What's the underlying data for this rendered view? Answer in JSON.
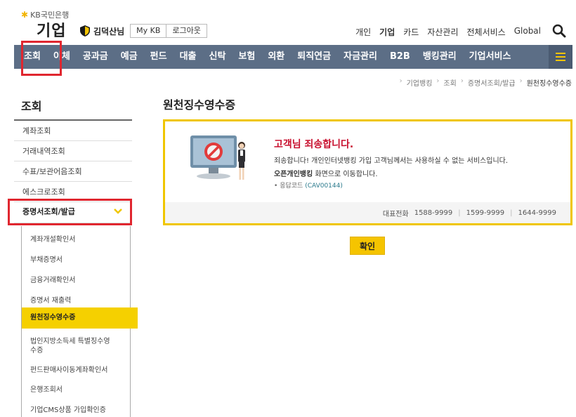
{
  "header": {
    "logo_sub": "KB국민은행",
    "logo_main": "기업",
    "user_name": "김덕산님",
    "my_kb": "My KB",
    "logout": "로그아웃",
    "top_links": [
      {
        "label": "개인",
        "bold": false
      },
      {
        "label": "기업",
        "bold": true
      },
      {
        "label": "카드",
        "bold": false
      },
      {
        "label": "자산관리",
        "bold": false
      },
      {
        "label": "전체서비스",
        "bold": false
      },
      {
        "label": "Global",
        "bold": false
      }
    ]
  },
  "nav": {
    "items": [
      "조회",
      "이체",
      "공과금",
      "예금",
      "펀드",
      "대출",
      "신탁",
      "보험",
      "외환",
      "퇴직연금",
      "자금관리",
      "B2B",
      "뱅킹관리",
      "기업서비스"
    ]
  },
  "breadcrumb": [
    "기업뱅킹",
    "조회",
    "증명서조회/발급",
    "원천징수영수증"
  ],
  "sidebar": {
    "title": "조회",
    "items": [
      "계좌조회",
      "거래내역조회",
      "수표/보관어음조회",
      "에스크로조회"
    ],
    "active": "증명서조회/발급",
    "sub_items": [
      "계좌개설확인서",
      "부채증명서",
      "금융거래확인서",
      "증명서 재출력",
      "원천징수영수증",
      "법인지방소득세 특별징수영",
      "수증",
      "펀드판매사이동계좌확인서",
      "은행조회서",
      "기업CMS상품 가입확인증"
    ]
  },
  "main": {
    "page_title": "원천징수영수증",
    "notice": {
      "title": "고객님 죄송합니다.",
      "desc": "죄송합니다! 개인인터넷뱅킹 가입 고객님께서는 사용하실 수 없는 서비스입니다.",
      "desc2_bold": "오픈개인뱅킹",
      "desc2_rest": " 화면으로 이동합니다.",
      "code_label": "응답코드",
      "code": "(CAV00144)"
    },
    "phones": {
      "label": "대표전화",
      "numbers": [
        "1588-9999",
        "1599-9999",
        "1644-9999"
      ]
    },
    "confirm": "확인"
  },
  "colors": {
    "nav_bg": "#5c6e86",
    "accent_yellow": "#f5c400",
    "highlight_red": "#e0262f",
    "notice_title": "#c8102e"
  }
}
